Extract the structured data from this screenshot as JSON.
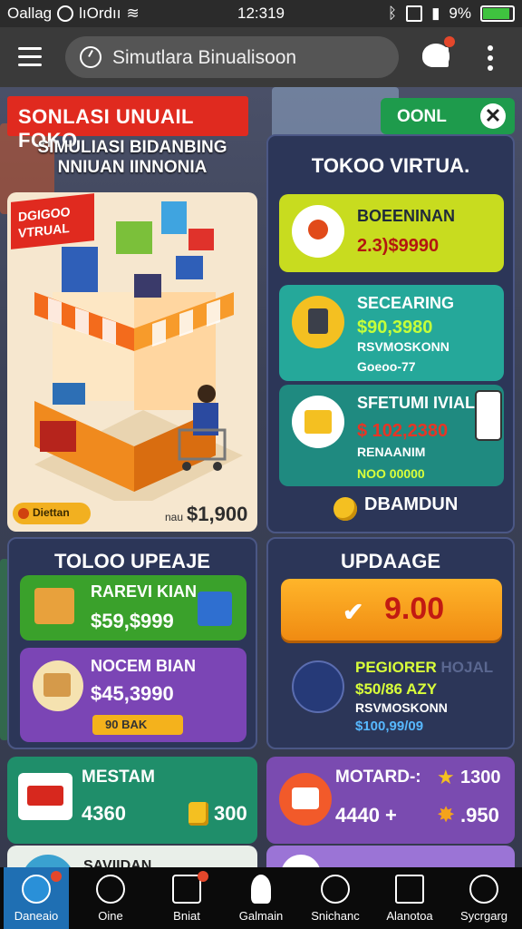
{
  "status_bar": {
    "left_text": "Oallag",
    "carrier": "lıOrdıı",
    "time": "12:319",
    "battery": "9%"
  },
  "top_bar": {
    "search_text": "Simutlara Binualisoon"
  },
  "header": {
    "banner": "SONLASI UNUAIL FOKO",
    "subtitle_line1": "SIMULIASI BIDANBING",
    "subtitle_line2": "NNIUAN IINNONIA",
    "ok_label": "OONL",
    "close_glyph": "✕"
  },
  "shop_card": {
    "tag_line1": "DGIGOO",
    "tag_line2": "VTRUAL",
    "pill_label": "Diettan",
    "price_prefix": "nau",
    "price": "$1,900"
  },
  "toko_virtual": {
    "title": "TOKOO VIRTUA.",
    "items": [
      {
        "name": "BOEENINAN",
        "price": "2.3)$9990",
        "sub": ""
      },
      {
        "name": "SECEARING",
        "price": "$90,3980",
        "sub": "RSVMOSKONN",
        "sub2": "Goeoo-77"
      },
      {
        "name": "SFETUMI IVIAL",
        "price": "$ 102,2380",
        "sub": "RENAANIM",
        "sub2": "NOO 00000"
      }
    ],
    "button": "DBAMDUN"
  },
  "toloo_upeaje": {
    "title": "TOLOO UPEAJE",
    "items": [
      {
        "name": "RAREVI KIAN",
        "price": "$59,$999"
      },
      {
        "name": "NOCEM BIAN",
        "price": "$45,3990",
        "tag": "90 BAK"
      }
    ]
  },
  "updaage": {
    "title": "UPDAAGE",
    "value": "9.00",
    "item_name": "PEGIORER",
    "item_name_faded": "HOJAL",
    "price": "$50/86 AZY",
    "sub": "RSVMOSKONN",
    "sub2": "$100,99/09"
  },
  "card_mestam": {
    "title": "MESTAM",
    "value": "4360",
    "coins": "300"
  },
  "card_motard": {
    "title": "MOTARD-:",
    "stars": "1300",
    "value": "4440 +",
    "score": ".950"
  },
  "card_bottom_left": {
    "title": "SAVIIDAN"
  },
  "nav": [
    {
      "label": "Daneaio"
    },
    {
      "label": "Oine"
    },
    {
      "label": "Bniat"
    },
    {
      "label": "Galmain"
    },
    {
      "label": "Snichanc"
    },
    {
      "label": "Alanotoa"
    },
    {
      "label": "Sycrgarg"
    }
  ]
}
